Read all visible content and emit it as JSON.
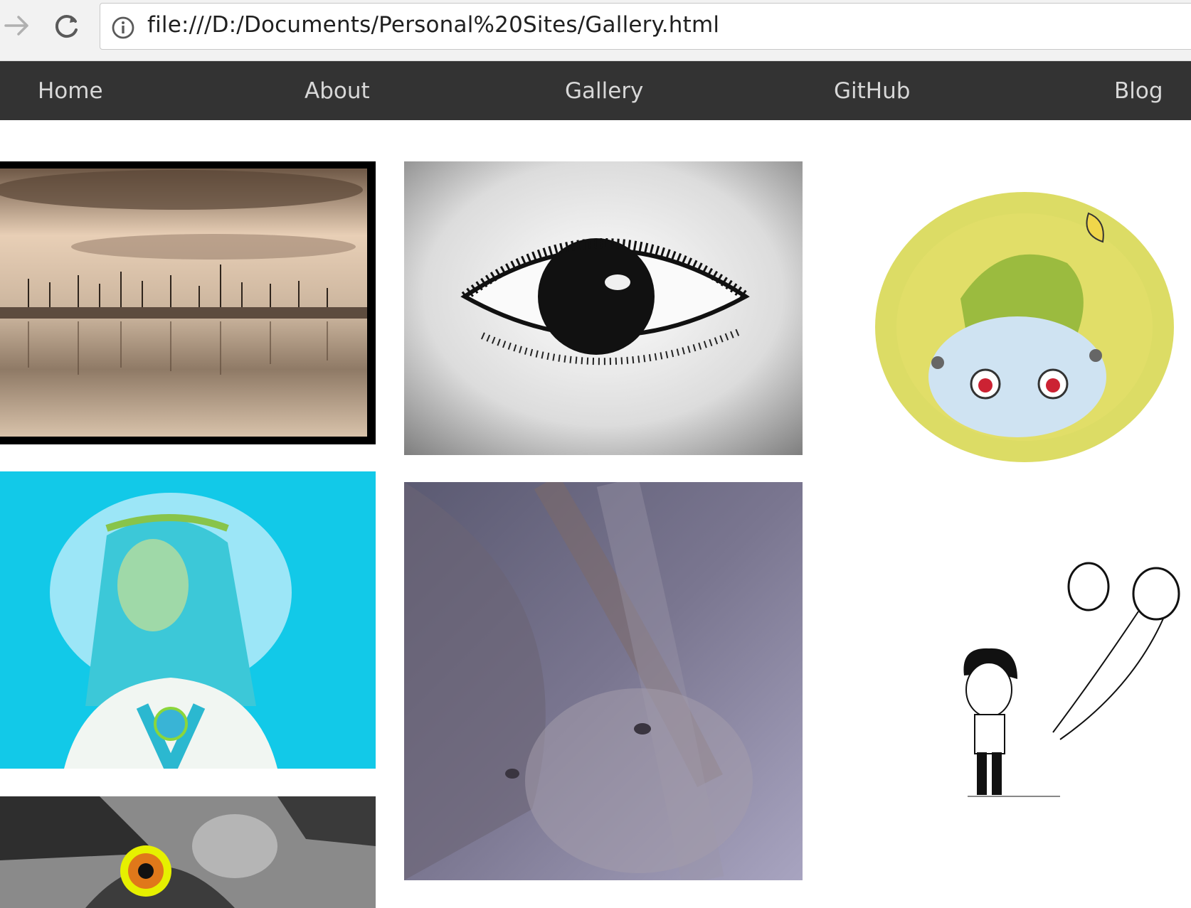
{
  "browser": {
    "url": "file:///D:/Documents/Personal%20Sites/Gallery.html"
  },
  "nav": {
    "items": [
      "Home",
      "About",
      "Gallery",
      "GitHub",
      "Blog"
    ]
  },
  "gallery": {
    "images": [
      "sepia-watercolor-forest-lake",
      "ink-eye-drawing",
      "bulbasaur-painting",
      "blue-haired-anime-girl",
      "soft-painted-face-with-hair",
      "boy-with-balloons-ink",
      "grey-creature-with-orange-eye"
    ]
  },
  "colors": {
    "nav_bg": "#333333",
    "nav_text": "#d8d8d8",
    "chrome_bg": "#f2f2f2"
  }
}
